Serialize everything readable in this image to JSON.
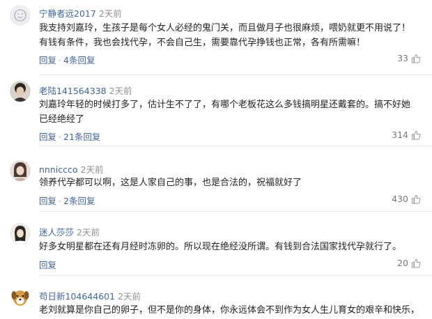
{
  "comments": [
    {
      "username": "宁静者远2017",
      "time": "2天前",
      "text": "我支持刘嘉玲，生孩子是每个女人必经的鬼门关，而且做月子也很麻烦，喂奶就更不用说了！有钱有条件，我也会找代孕，不会自己生，需要靠代孕挣钱也正常，各有所需嘛！",
      "reply_label": "回复",
      "dot": "·",
      "replies_label": "4条回复",
      "likes": "33",
      "avatar_icon": "smile-face-avatar-icon"
    },
    {
      "username": "老陆141564338",
      "time": "2天前",
      "text": "刘嘉玲年轻的时候打多了，估计生不了了，有哪个老板花这么多钱搞明星还戴套的。搞不好她已经绝经了",
      "reply_label": "回复",
      "dot": "·",
      "replies_label": "21条回复",
      "likes": "314",
      "avatar_icon": "photo-avatar-icon"
    },
    {
      "username": "nnnicсco",
      "time": "2天前",
      "text": "领养代孕都可以啊，这是人家自己的事，也是合法的，祝福就好了",
      "reply_label": "回复",
      "dot": "·",
      "replies_label": "2条回复",
      "likes": "430",
      "avatar_icon": "photo-avatar-icon"
    },
    {
      "username": "迷人莎莎",
      "time": "2天前",
      "text": "好多女明星都在还有月经时冻卵的。所以现在绝经没所谓。有钱到合法国家找代孕就行了。",
      "reply_label": "回复",
      "likes": "20",
      "avatar_icon": "photo-avatar-icon"
    },
    {
      "username": "苟日新104644601",
      "time": "2天前",
      "text": "老刘就算是你自己的卵子，但不是你的身体，你永远体会不到作为女人生儿育女的艰辛和快乐，感觉",
      "avatar_icon": "dog-avatar-icon"
    }
  ],
  "colors": {
    "username": "#406599",
    "time": "#8f8f8f",
    "text": "#222222",
    "divider": "#ececec"
  }
}
